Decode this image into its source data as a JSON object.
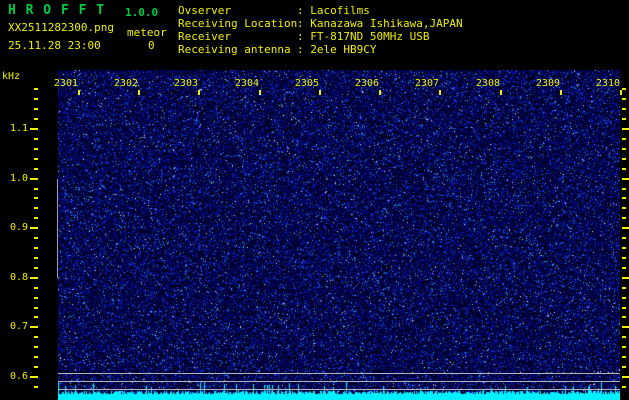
{
  "header": {
    "app_title": "H R O F F T",
    "version": "1.0.0",
    "filename": "XX2511282300.png",
    "mode_label": "meteor",
    "timestamp": "25.11.28 23:00",
    "meteor_count": "0",
    "colon": ":",
    "info_rows": [
      {
        "label": "Ovserver",
        "value": "Lacofilms"
      },
      {
        "label": "Receiving Location",
        "value": "Kanazawa Ishikawa,JAPAN"
      },
      {
        "label": "Receiver",
        "value": "FT-817ND 50MHz USB"
      },
      {
        "label": "Receiving antenna",
        "value": "2ele HB9CY"
      }
    ]
  },
  "spectrogram": {
    "freq_axis": {
      "unit": "kHz",
      "major_tick_khz": [
        1.1,
        1.0,
        0.9,
        0.8,
        0.7,
        0.6
      ],
      "minor_step_khz": 0.02,
      "top_khz": 1.18,
      "bottom_khz": 0.58
    },
    "time_axis": {
      "labels": [
        "2301",
        "2302",
        "2303",
        "2304",
        "2305",
        "2306",
        "2307",
        "2308",
        "2309",
        "2310"
      ]
    },
    "reference_lines_khz": [
      0.608,
      0.592,
      0.576
    ],
    "detection_band_khz": [
      1.0,
      0.8
    ]
  },
  "colors": {
    "background": "#000000",
    "title_green": "#00cc44",
    "label_yellow": "#f0f000",
    "gray_line": "#b4b4b4",
    "noise_dark_blue": "#000066",
    "noise_mid_blue": "#0000cc",
    "noise_bright_blue": "#3355ff",
    "meter_cyan": "#00f0ff"
  },
  "chart_data": {
    "type": "heatmap",
    "title": "HROFFT 1.0.0 radio meteor echo spectrogram",
    "x_tick_labels": [
      "2301",
      "2302",
      "2303",
      "2304",
      "2305",
      "2306",
      "2307",
      "2308",
      "2309",
      "2310"
    ],
    "x_range": [
      "23:00",
      "23:10"
    ],
    "ylabel": "kHz",
    "y_tick_labels": [
      1.1,
      1.0,
      0.9,
      0.8,
      0.7,
      0.6
    ],
    "y_range_khz": [
      0.58,
      1.22
    ],
    "legend_position": "none",
    "grid": false,
    "content_description": "uniform dark-blue background radio noise; no meteor echo traces visible during 23:00-23:10",
    "meteor_count": 0,
    "reference_lines_khz": [
      0.608,
      0.592,
      0.576
    ],
    "detection_band_marker_khz": [
      1.0,
      0.8
    ],
    "bottom_strip": "cyan signal-level meter showing near-constant noise floor across all 10 minutes"
  }
}
